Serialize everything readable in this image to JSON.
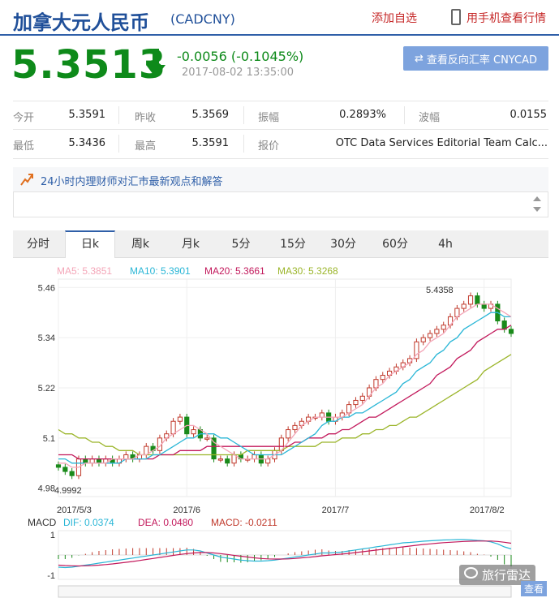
{
  "header": {
    "title": "加拿大元人民币",
    "code": "(CADCNY)",
    "add_favorite": "添加自选",
    "mobile_link": "用手机查看行情"
  },
  "quote": {
    "price": "5.3513",
    "change": "-0.0056 (-0.1045%)",
    "timestamp": "2017-08-02 13:35:00",
    "reverse_button": "查看反向汇率 CNYCAD"
  },
  "stats": [
    [
      {
        "label": "今开",
        "value": "5.3591"
      },
      {
        "label": "昨收",
        "value": "5.3569"
      },
      {
        "label": "振幅",
        "value": "0.2893%"
      },
      {
        "label": "波幅",
        "value": "0.0155"
      }
    ],
    [
      {
        "label": "最低",
        "value": "5.3436"
      },
      {
        "label": "最高",
        "value": "5.3591"
      },
      {
        "label": "报价",
        "value": "OTC Data Services Editorial Team Calc..."
      },
      {
        "label": "",
        "value": ""
      }
    ]
  ],
  "advisor": {
    "text": "24小时内理财师对汇市最新观点和解答"
  },
  "tabs": [
    "分时",
    "日k",
    "周k",
    "月k",
    "5分",
    "15分",
    "30分",
    "60分",
    "4h"
  ],
  "active_tab": 1,
  "colors": {
    "up": "#c0392b",
    "down": "#1a8a1a",
    "ma5": "#f4a6b8",
    "ma10": "#29b6d6",
    "ma20": "#c2185b",
    "ma30": "#9bb52a"
  },
  "watermark": {
    "text": "旅行雷达",
    "view": "查看"
  },
  "chart_data": [
    {
      "type": "candlestick",
      "legend": [
        {
          "name": "MA5",
          "value": "5.3851"
        },
        {
          "name": "MA10",
          "value": "5.3901"
        },
        {
          "name": "MA20",
          "value": "5.3661"
        },
        {
          "name": "MA30",
          "value": "5.3268"
        }
      ],
      "ylim": [
        4.96,
        5.48
      ],
      "yticks": [
        "5.46",
        "5.34",
        "5.22",
        "5.1",
        "4.98"
      ],
      "xticks": [
        "2017/5/3",
        "2017/6",
        "2017/7",
        "2017/8/2"
      ],
      "xtick_index": [
        0,
        19,
        41,
        63
      ],
      "annotations": [
        {
          "label": "5.4358",
          "index": 58,
          "value": 5.4358
        },
        {
          "label": "4.9992",
          "index": 3,
          "value": 4.9992
        }
      ],
      "closes": [
        5.03,
        5.02,
        5.01,
        5.05,
        5.04,
        5.05,
        5.04,
        5.05,
        5.04,
        5.05,
        5.06,
        5.05,
        5.06,
        5.08,
        5.07,
        5.1,
        5.11,
        5.14,
        5.15,
        5.11,
        5.12,
        5.1,
        5.1,
        5.05,
        5.05,
        5.04,
        5.06,
        5.05,
        5.05,
        5.06,
        5.04,
        5.05,
        5.07,
        5.1,
        5.12,
        5.13,
        5.14,
        5.15,
        5.15,
        5.16,
        5.14,
        5.15,
        5.16,
        5.18,
        5.19,
        5.2,
        5.22,
        5.24,
        5.25,
        5.26,
        5.27,
        5.28,
        5.29,
        5.33,
        5.34,
        5.35,
        5.36,
        5.37,
        5.39,
        5.41,
        5.42,
        5.44,
        5.42,
        5.41,
        5.42,
        5.38,
        5.36,
        5.35
      ],
      "ma5": [
        5.04,
        5.04,
        5.03,
        5.03,
        5.04,
        5.04,
        5.04,
        5.04,
        5.05,
        5.05,
        5.05,
        5.05,
        5.06,
        5.06,
        5.07,
        5.08,
        5.1,
        5.11,
        5.12,
        5.13,
        5.13,
        5.12,
        5.11,
        5.09,
        5.08,
        5.07,
        5.06,
        5.05,
        5.05,
        5.05,
        5.05,
        5.05,
        5.06,
        5.07,
        5.09,
        5.11,
        5.13,
        5.14,
        5.15,
        5.15,
        5.15,
        5.15,
        5.15,
        5.16,
        5.17,
        5.18,
        5.2,
        5.22,
        5.23,
        5.25,
        5.26,
        5.27,
        5.28,
        5.3,
        5.31,
        5.33,
        5.34,
        5.35,
        5.37,
        5.39,
        5.4,
        5.41,
        5.42,
        5.42,
        5.42,
        5.41,
        5.4,
        5.39
      ],
      "ma10": [
        5.05,
        5.05,
        5.04,
        5.04,
        5.04,
        5.04,
        5.04,
        5.04,
        5.04,
        5.04,
        5.05,
        5.05,
        5.05,
        5.05,
        5.06,
        5.06,
        5.07,
        5.08,
        5.09,
        5.1,
        5.1,
        5.11,
        5.11,
        5.11,
        5.1,
        5.1,
        5.09,
        5.08,
        5.07,
        5.06,
        5.06,
        5.06,
        5.06,
        5.06,
        5.07,
        5.08,
        5.09,
        5.1,
        5.11,
        5.13,
        5.14,
        5.14,
        5.15,
        5.15,
        5.16,
        5.16,
        5.17,
        5.18,
        5.19,
        5.2,
        5.21,
        5.23,
        5.24,
        5.26,
        5.27,
        5.28,
        5.3,
        5.31,
        5.33,
        5.34,
        5.36,
        5.37,
        5.38,
        5.39,
        5.4,
        5.4,
        5.39,
        5.39
      ],
      "ma20": [
        5.06,
        5.06,
        5.06,
        5.05,
        5.05,
        5.05,
        5.05,
        5.05,
        5.05,
        5.05,
        5.05,
        5.05,
        5.05,
        5.05,
        5.05,
        5.06,
        5.06,
        5.06,
        5.07,
        5.07,
        5.07,
        5.07,
        5.08,
        5.08,
        5.08,
        5.08,
        5.08,
        5.08,
        5.08,
        5.08,
        5.08,
        5.08,
        5.08,
        5.08,
        5.08,
        5.09,
        5.09,
        5.1,
        5.1,
        5.1,
        5.11,
        5.11,
        5.12,
        5.12,
        5.13,
        5.14,
        5.15,
        5.15,
        5.16,
        5.17,
        5.18,
        5.19,
        5.2,
        5.21,
        5.22,
        5.23,
        5.25,
        5.26,
        5.27,
        5.29,
        5.3,
        5.31,
        5.33,
        5.34,
        5.35,
        5.36,
        5.36,
        5.37
      ],
      "ma30": [
        5.12,
        5.11,
        5.11,
        5.1,
        5.1,
        5.09,
        5.09,
        5.08,
        5.08,
        5.07,
        5.07,
        5.07,
        5.06,
        5.06,
        5.06,
        5.06,
        5.06,
        5.06,
        5.06,
        5.06,
        5.06,
        5.06,
        5.06,
        5.06,
        5.06,
        5.06,
        5.06,
        5.06,
        5.07,
        5.07,
        5.07,
        5.07,
        5.07,
        5.07,
        5.08,
        5.08,
        5.08,
        5.08,
        5.08,
        5.09,
        5.09,
        5.09,
        5.1,
        5.1,
        5.1,
        5.11,
        5.11,
        5.12,
        5.12,
        5.13,
        5.13,
        5.14,
        5.15,
        5.15,
        5.16,
        5.17,
        5.18,
        5.19,
        5.2,
        5.21,
        5.22,
        5.23,
        5.24,
        5.26,
        5.27,
        5.28,
        5.29,
        5.3
      ]
    },
    {
      "type": "line",
      "legend": [
        {
          "name": "MACD",
          "value": ""
        },
        {
          "name": "DIF",
          "value": "0.0374"
        },
        {
          "name": "DEA",
          "value": "0.0480"
        },
        {
          "name": "MACD",
          "value": "-0.0211"
        }
      ],
      "ylim": [
        -1.2,
        1.2
      ],
      "yticks": [
        "1",
        "-1"
      ],
      "dif": [
        -0.6,
        -0.62,
        -0.6,
        -0.55,
        -0.5,
        -0.45,
        -0.4,
        -0.35,
        -0.3,
        -0.25,
        -0.2,
        -0.15,
        -0.1,
        -0.05,
        0.0,
        0.05,
        0.1,
        0.15,
        0.2,
        0.25,
        0.25,
        0.2,
        0.1,
        0.0,
        -0.1,
        -0.15,
        -0.2,
        -0.25,
        -0.28,
        -0.3,
        -0.3,
        -0.28,
        -0.25,
        -0.2,
        -0.15,
        -0.1,
        -0.05,
        0.0,
        0.05,
        0.1,
        0.1,
        0.12,
        0.15,
        0.2,
        0.25,
        0.3,
        0.35,
        0.4,
        0.45,
        0.5,
        0.55,
        0.6,
        0.62,
        0.65,
        0.68,
        0.7,
        0.72,
        0.74,
        0.75,
        0.76,
        0.76,
        0.75,
        0.72,
        0.7,
        0.65,
        0.55,
        0.4,
        0.3
      ],
      "dea": [
        -0.5,
        -0.52,
        -0.53,
        -0.54,
        -0.53,
        -0.52,
        -0.5,
        -0.47,
        -0.44,
        -0.4,
        -0.36,
        -0.32,
        -0.27,
        -0.22,
        -0.17,
        -0.12,
        -0.07,
        -0.02,
        0.03,
        0.07,
        0.1,
        0.12,
        0.12,
        0.1,
        0.07,
        0.03,
        -0.02,
        -0.06,
        -0.1,
        -0.14,
        -0.17,
        -0.19,
        -0.2,
        -0.2,
        -0.19,
        -0.17,
        -0.14,
        -0.11,
        -0.08,
        -0.04,
        -0.01,
        0.02,
        0.05,
        0.08,
        0.12,
        0.16,
        0.2,
        0.24,
        0.28,
        0.32,
        0.36,
        0.4,
        0.44,
        0.48,
        0.52,
        0.55,
        0.58,
        0.61,
        0.63,
        0.65,
        0.67,
        0.68,
        0.69,
        0.69,
        0.69,
        0.67,
        0.63,
        0.58
      ]
    }
  ]
}
